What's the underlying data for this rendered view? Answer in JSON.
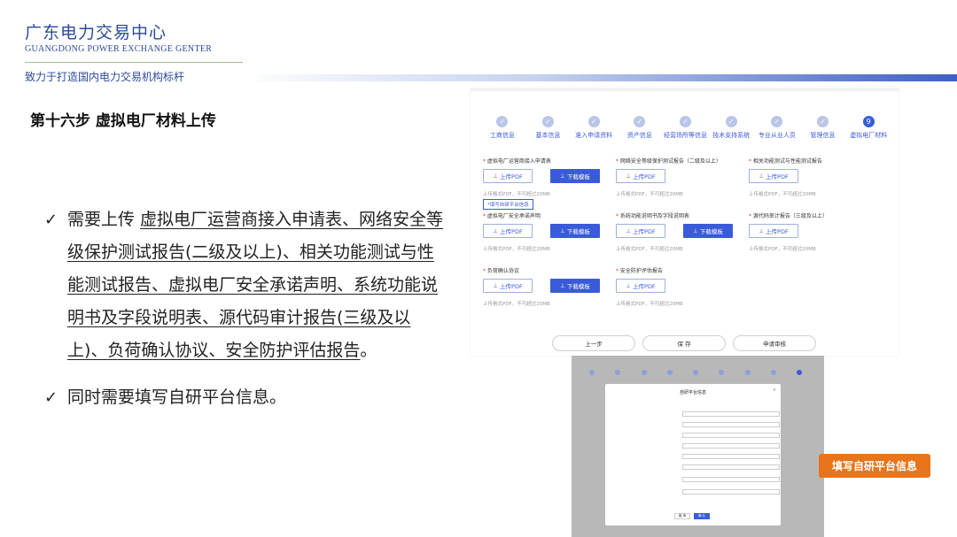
{
  "header": {
    "org_cn": "广东电力交易中心",
    "org_en": "GUANGDONG POWER EXCHANGE GENTER",
    "slogan": "致力于打造国内电力交易机构标杆"
  },
  "step_title": "第十六步 虚拟电厂材料上传",
  "bullets": [
    {
      "prefix": "需要上传 ",
      "underlined": "虚拟电厂运营商接入申请表、网络安全等级保护测试报告(二级及以上)、相关功能测试与性能测试报告、虚拟电厂安全承诺声明、系统功能说明书及字段说明表、源代码审计报告(三级及以上)、负荷确认协议、安全防护评估报告",
      "suffix": "。"
    },
    {
      "prefix": "同时需要填写自研平台信息。",
      "underlined": "",
      "suffix": ""
    }
  ],
  "check_glyph": "✓",
  "screenshot": {
    "steps": [
      {
        "label": "工商信息",
        "num": "✓"
      },
      {
        "label": "基本信息",
        "num": "✓"
      },
      {
        "label": "准入申请资料",
        "num": "✓"
      },
      {
        "label": "资产信息",
        "num": "✓"
      },
      {
        "label": "经营场所等信息",
        "num": "✓"
      },
      {
        "label": "技术支持系统",
        "num": "✓"
      },
      {
        "label": "专业从业人员",
        "num": "✓"
      },
      {
        "label": "管理信息",
        "num": "✓"
      },
      {
        "label": "虚拟电厂材料",
        "num": "9"
      }
    ],
    "upload_label": "上传PDF",
    "download_label": "下载模板",
    "hint": "上传格式PDF，不可超过20MB",
    "self_platform_tag": "*填写自研平台信息",
    "rows": [
      [
        {
          "title": "虚拟电厂运营商接入申请表",
          "download": true
        },
        {
          "title": "网络安全等级保护测试报告（二级及以上）",
          "download": false
        },
        {
          "title": "相关功能测试与性能测试报告",
          "download": false
        }
      ],
      [
        {
          "title": "虚拟电厂安全承诺声明",
          "download": true
        },
        {
          "title": "系统功能说明书及字段说明表",
          "download": true
        },
        {
          "title": "源代码审计报告（三级及以上）",
          "download": false
        }
      ],
      [
        {
          "title": "负荷确认协议",
          "download": true
        },
        {
          "title": "安全防护评估报告",
          "download": false
        }
      ]
    ],
    "nav": {
      "prev": "上一步",
      "save": "保 存",
      "submit": "申请审核"
    }
  },
  "modal": {
    "title": "自研平台信息",
    "close": "×",
    "cancel": "取 消",
    "confirm": "确 认"
  },
  "callout": "填写自研平台信息",
  "colors": {
    "primary": "#3a5bd9",
    "brand": "#2b4a9a",
    "callout": "#e8741c"
  }
}
